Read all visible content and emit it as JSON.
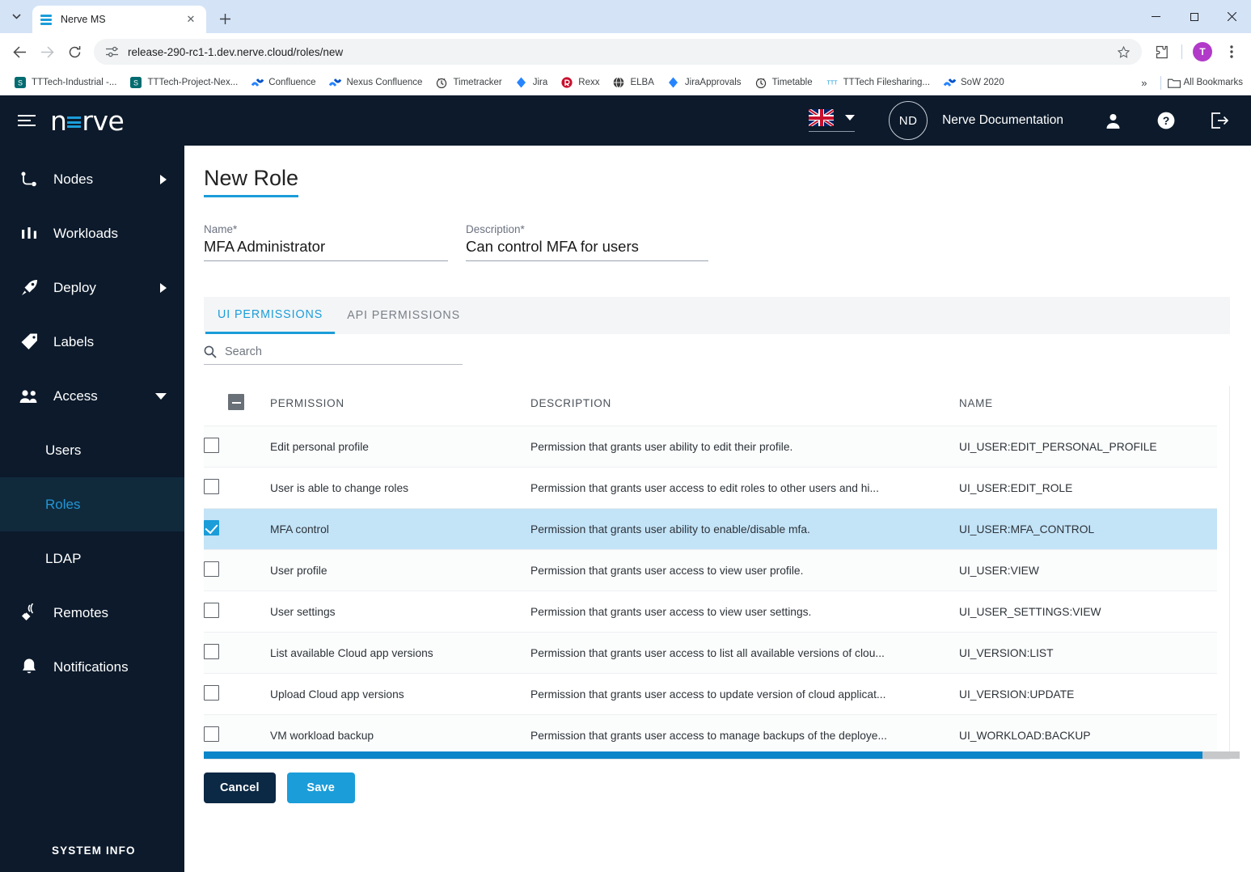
{
  "browser": {
    "tab": {
      "title": "Nerve MS",
      "favicon": "nerve-lines-icon"
    },
    "new_tab_label": "+",
    "window_controls": {
      "minimize": "–",
      "maximize": "□",
      "close": "×"
    },
    "nav": {
      "back": "←",
      "forward": "→",
      "reload": "⟳"
    },
    "url": "release-290-rc1-1.dev.nerve.cloud/roles/new",
    "profile_initial": "T",
    "bookmarks": [
      {
        "label": "TTTech-Industrial -...",
        "icon": "sharepoint-icon"
      },
      {
        "label": "TTTech-Project-Nex...",
        "icon": "sharepoint-icon"
      },
      {
        "label": "Confluence",
        "icon": "confluence-icon"
      },
      {
        "label": "Nexus Confluence",
        "icon": "confluence-icon"
      },
      {
        "label": "Timetracker",
        "icon": "clock-icon"
      },
      {
        "label": "Jira",
        "icon": "jira-icon"
      },
      {
        "label": "Rexx",
        "icon": "rexx-icon"
      },
      {
        "label": "ELBA",
        "icon": "globe-icon"
      },
      {
        "label": "JiraApprovals",
        "icon": "jira-icon"
      },
      {
        "label": "Timetable",
        "icon": "clock-icon"
      },
      {
        "label": "TTTech Filesharing...",
        "icon": "tttech-icon"
      },
      {
        "label": "SoW 2020",
        "icon": "confluence-icon"
      }
    ],
    "bookmarks_overflow": "»",
    "all_bookmarks_label": "All Bookmarks"
  },
  "app_header": {
    "menu_icon": "hamburger-icon",
    "logo_text": "nerve",
    "language": {
      "flag": "uk-flag-icon",
      "caret": "chevron-down-icon"
    },
    "user_initials": "ND",
    "user_name": "Nerve Documentation",
    "icons": [
      "user-icon",
      "help-icon",
      "logout-icon"
    ]
  },
  "sidebar": {
    "items": [
      {
        "label": "Nodes",
        "icon": "nodes-icon",
        "expandable": true,
        "state": "collapsed"
      },
      {
        "label": "Workloads",
        "icon": "workloads-icon",
        "expandable": false
      },
      {
        "label": "Deploy",
        "icon": "deploy-rocket-icon",
        "expandable": true,
        "state": "collapsed"
      },
      {
        "label": "Labels",
        "icon": "labels-tag-icon",
        "expandable": false
      },
      {
        "label": "Access",
        "icon": "access-users-icon",
        "expandable": true,
        "state": "expanded"
      }
    ],
    "sub_items": [
      {
        "label": "Users",
        "active": false
      },
      {
        "label": "Roles",
        "active": true
      },
      {
        "label": "LDAP",
        "active": false
      }
    ],
    "items_after": [
      {
        "label": "Remotes",
        "icon": "remotes-icon",
        "expandable": false
      },
      {
        "label": "Notifications",
        "icon": "bell-icon",
        "expandable": false
      }
    ],
    "footer_label": "SYSTEM INFO"
  },
  "main": {
    "page_title": "New Role",
    "fields": {
      "name": {
        "label": "Name*",
        "value": "MFA Administrator"
      },
      "description": {
        "label": "Description*",
        "value": "Can control MFA for users"
      }
    },
    "tabs": [
      {
        "label": "UI PERMISSIONS",
        "active": true
      },
      {
        "label": "API PERMISSIONS",
        "active": false
      }
    ],
    "search": {
      "placeholder": "Search",
      "value": "",
      "icon": "search-icon"
    },
    "table": {
      "header_checkbox_state": "indeterminate",
      "columns": [
        "PERMISSION",
        "DESCRIPTION",
        "NAME"
      ],
      "rows": [
        {
          "checked": false,
          "permission": "Edit personal profile",
          "description": "Permission that grants user ability to edit their profile.",
          "name": "UI_USER:EDIT_PERSONAL_PROFILE"
        },
        {
          "checked": false,
          "permission": "User is able to change roles",
          "description": "Permission that grants user access to edit roles to other users and hi...",
          "name": "UI_USER:EDIT_ROLE"
        },
        {
          "checked": true,
          "permission": "MFA control",
          "description": "Permission that grants user ability to enable/disable mfa.",
          "name": "UI_USER:MFA_CONTROL"
        },
        {
          "checked": false,
          "permission": "User profile",
          "description": "Permission that grants user access to view user profile.",
          "name": "UI_USER:VIEW"
        },
        {
          "checked": false,
          "permission": "User settings",
          "description": "Permission that grants user access to view user settings.",
          "name": "UI_USER_SETTINGS:VIEW"
        },
        {
          "checked": false,
          "permission": "List available Cloud app versions",
          "description": "Permission that grants user access to list all available versions of clou...",
          "name": "UI_VERSION:LIST"
        },
        {
          "checked": false,
          "permission": "Upload Cloud app versions",
          "description": "Permission that grants user access to update version of cloud applicat...",
          "name": "UI_VERSION:UPDATE"
        },
        {
          "checked": false,
          "permission": "VM workload backup",
          "description": "Permission that grants user access to manage backups of the deploye...",
          "name": "UI_WORKLOAD:BACKUP"
        }
      ]
    },
    "buttons": {
      "cancel": "Cancel",
      "save": "Save"
    }
  },
  "colors": {
    "brand_dark": "#0c1a2b",
    "accent_blue": "#1b9dd9",
    "selected_row": "#c3e3f7",
    "cancel_button": "#0b2844",
    "scrollbar_thumb": "#0b86c9"
  }
}
